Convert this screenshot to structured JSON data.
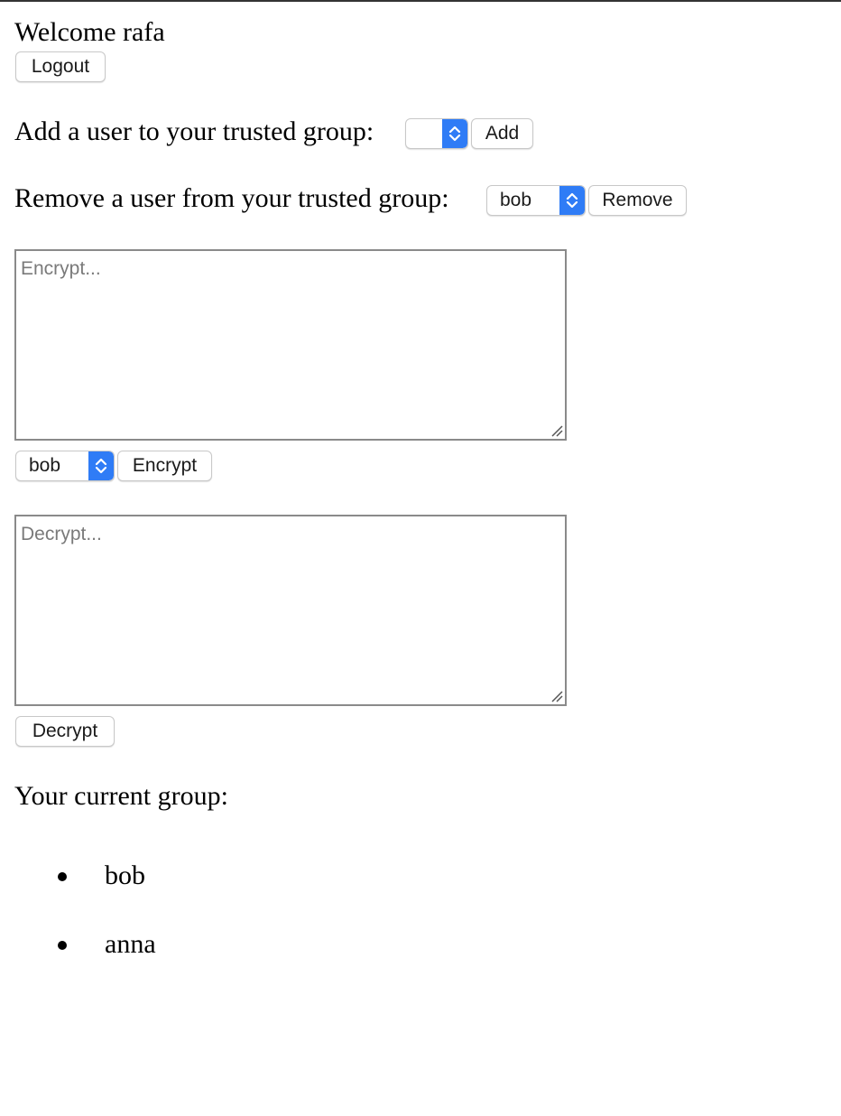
{
  "header": {
    "welcome_text": "Welcome rafa",
    "logout_label": "Logout"
  },
  "add_user": {
    "label": "Add a user to your trusted group:",
    "selected_value": "",
    "button_label": "Add"
  },
  "remove_user": {
    "label": "Remove a user from your trusted group:",
    "selected_value": "bob",
    "button_label": "Remove"
  },
  "encrypt": {
    "placeholder": "Encrypt...",
    "recipient_value": "bob",
    "button_label": "Encrypt"
  },
  "decrypt": {
    "placeholder": "Decrypt...",
    "button_label": "Decrypt"
  },
  "group": {
    "heading": "Your current group:",
    "members": [
      "bob",
      "anna"
    ]
  },
  "colors": {
    "select_accent": "#2f7cf6"
  }
}
